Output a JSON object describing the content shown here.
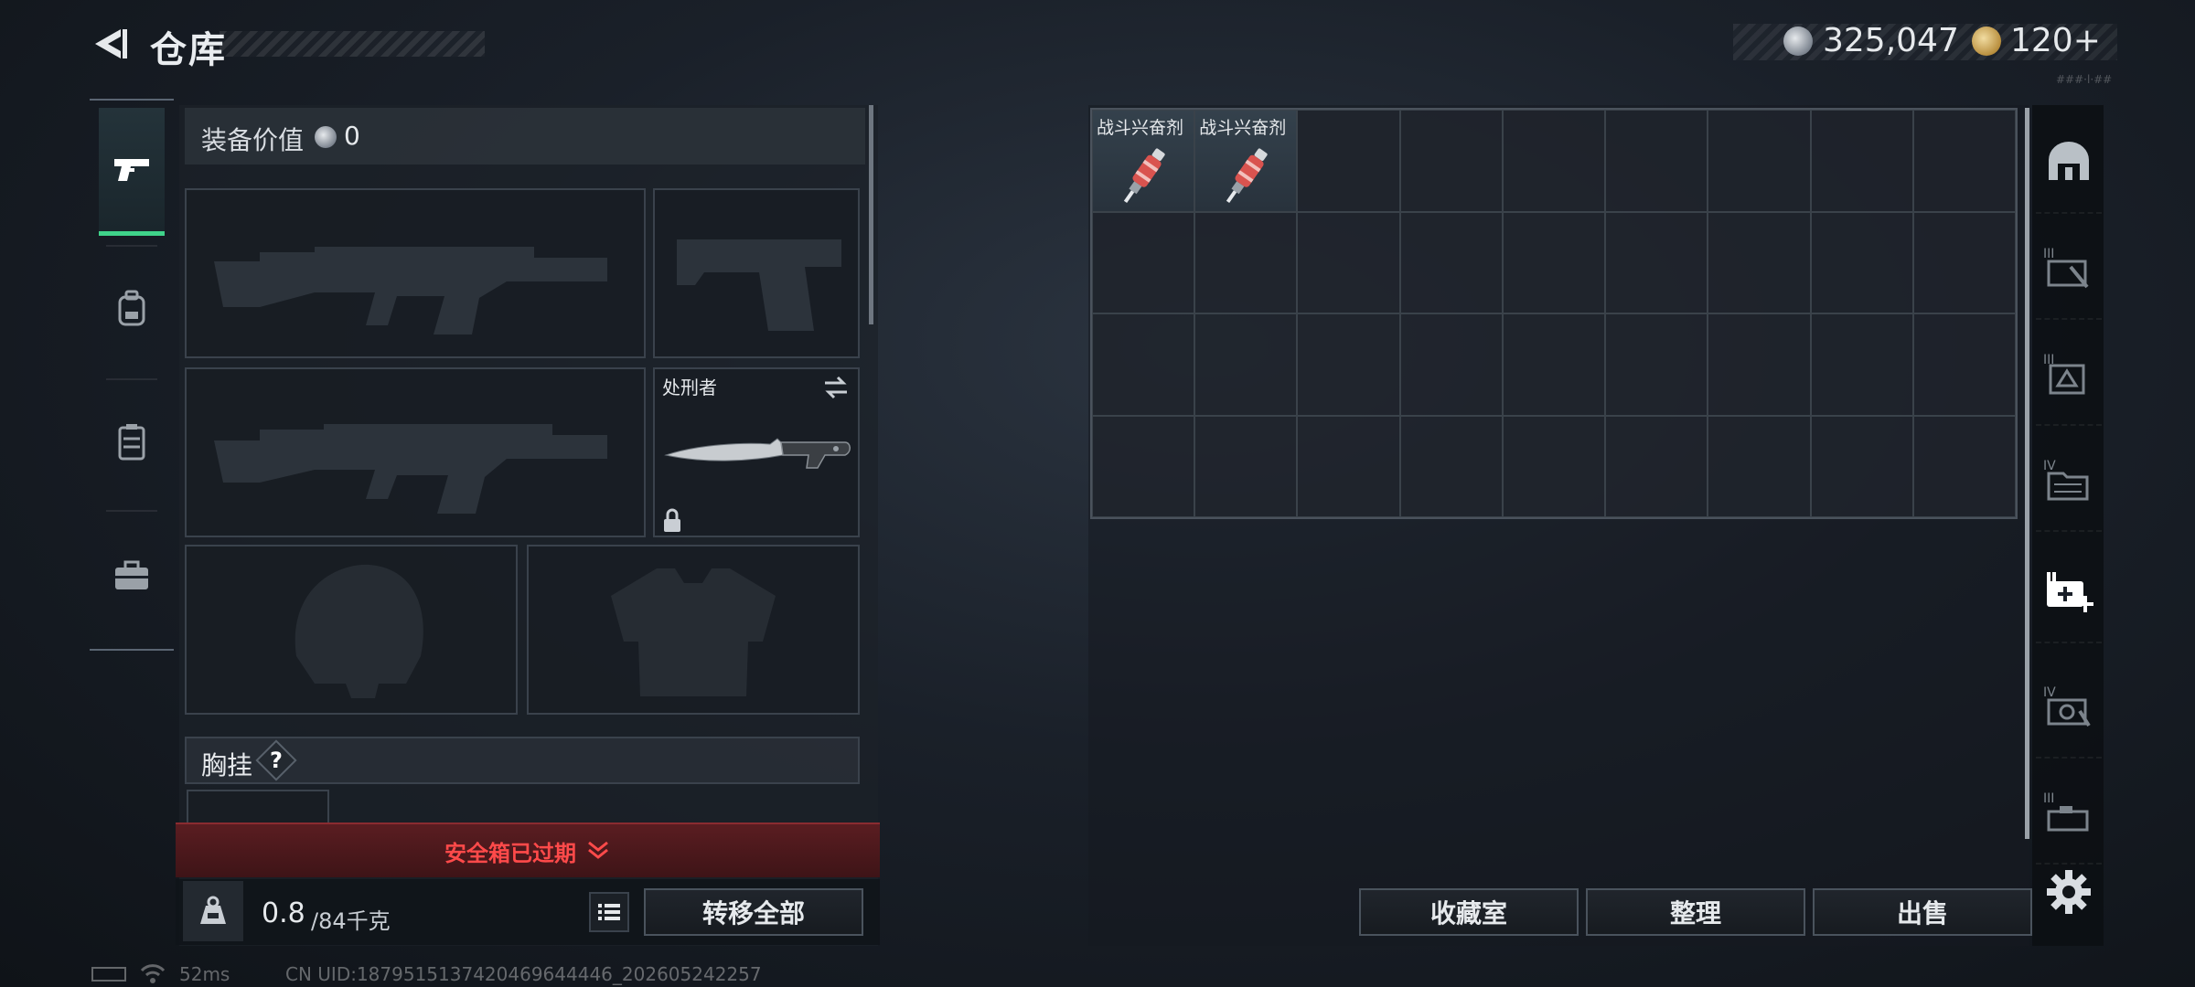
{
  "header": {
    "title": "仓库",
    "back_icon": "back-arrow-icon",
    "currency_silver": "325,047",
    "currency_gold": "120+",
    "faint_text": "###·l·##"
  },
  "nav": {
    "items": [
      {
        "icon": "pistol-icon",
        "active": true
      },
      {
        "icon": "backpack-icon",
        "active": false
      },
      {
        "icon": "vest-icon",
        "active": false
      },
      {
        "icon": "toolbox-icon",
        "active": false
      }
    ]
  },
  "equipment": {
    "value_label": "装备价值",
    "value": "0",
    "melee_label": "处刑者",
    "chest_label": "胸挂",
    "help_glyph": "?",
    "warning": "安全箱已过期",
    "weight_current": "0.8",
    "weight_max": "/84千克",
    "transfer_all_label": "转移全部"
  },
  "storage": {
    "items": [
      {
        "name": "战斗兴奋剂",
        "icon": "stim-injector-icon",
        "cell": 0
      },
      {
        "name": "战斗兴奋剂",
        "icon": "stim-injector-icon",
        "cell": 1
      }
    ],
    "columns": 9,
    "rows": 4,
    "collection_label": "收藏室",
    "sort_label": "整理",
    "sell_label": "出售"
  },
  "categories": [
    {
      "icon": "helmet-category-icon"
    },
    {
      "icon": "weapon-case-iii-icon"
    },
    {
      "icon": "medkit-iii-icon"
    },
    {
      "icon": "folder-iv-icon"
    },
    {
      "icon": "medical-plus-icon",
      "active": true
    },
    {
      "icon": "camera-iv-icon"
    },
    {
      "icon": "box-iii-icon"
    }
  ],
  "status": {
    "ping": "52ms",
    "uid": "CN UID:1879515137420469644446_202605242257"
  }
}
